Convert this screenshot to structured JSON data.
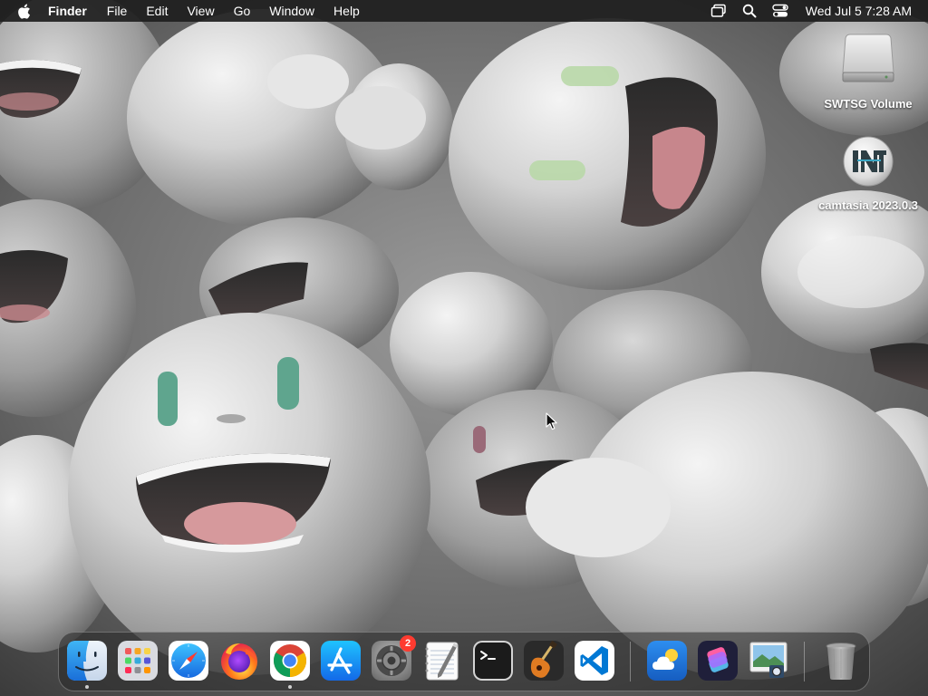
{
  "menubar": {
    "app_name": "Finder",
    "menus": [
      "File",
      "Edit",
      "View",
      "Go",
      "Window",
      "Help"
    ],
    "clock": "Wed Jul 5  7:28 AM",
    "status_icons": [
      "screen-mirroring-icon",
      "spotlight-search-icon",
      "control-center-icon"
    ]
  },
  "desktop": {
    "icons": [
      {
        "label": "SWTSG Volume",
        "icon": "external-drive-icon"
      },
      {
        "label": "camtasia 2023.0.3",
        "icon": "disk-image-icon"
      }
    ]
  },
  "dock": {
    "apps": [
      {
        "name": "Finder",
        "icon": "finder-icon",
        "running": true
      },
      {
        "name": "Launchpad",
        "icon": "launchpad-icon",
        "running": false
      },
      {
        "name": "Safari",
        "icon": "safari-icon",
        "running": false
      },
      {
        "name": "Firefox",
        "icon": "firefox-icon",
        "running": false
      },
      {
        "name": "Google Chrome",
        "icon": "chrome-icon",
        "running": true
      },
      {
        "name": "App Store",
        "icon": "app-store-icon",
        "running": false
      },
      {
        "name": "System Settings",
        "icon": "system-settings-icon",
        "running": false,
        "badge": "2"
      },
      {
        "name": "TextEdit",
        "icon": "textedit-icon",
        "running": false
      },
      {
        "name": "Terminal",
        "icon": "terminal-icon",
        "running": false
      },
      {
        "name": "GarageBand",
        "icon": "garageband-icon",
        "running": false
      },
      {
        "name": "Visual Studio Code",
        "icon": "vscode-icon",
        "running": false
      },
      {
        "name": "Weather",
        "icon": "weather-icon",
        "running": false
      },
      {
        "name": "Shortcuts",
        "icon": "shortcuts-icon",
        "running": false
      },
      {
        "name": "Preview",
        "icon": "preview-icon",
        "running": false
      },
      {
        "name": "Trash",
        "icon": "trash-icon",
        "running": false
      }
    ]
  },
  "colors": {
    "menubar_bg": "#1e1e1e",
    "badge": "#ff3b30",
    "vscode_blue": "#0078d4"
  }
}
